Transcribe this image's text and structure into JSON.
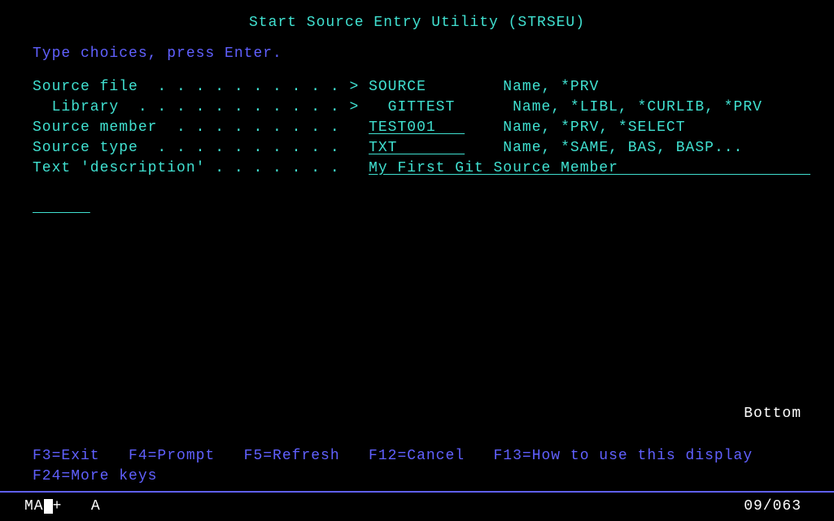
{
  "title": "Start Source Entry Utility  (STRSEU)",
  "instruction": "Type choices, press Enter.",
  "fields": {
    "source_file": {
      "label": "Source file  . . . . . . . . . . > ",
      "value": "SOURCE       ",
      "hint": " Name, *PRV"
    },
    "library": {
      "label": "  Library  . . . . . . . . . . . >  ",
      "value": " GITTEST     ",
      "hint": " Name, *LIBL, *CURLIB, *PRV"
    },
    "source_member": {
      "label": "Source member  . . . . . . . . .   ",
      "value": "TEST001   ",
      "hint": "    Name, *PRV, *SELECT"
    },
    "source_type": {
      "label": "Source type  . . . . . . . . . .   ",
      "value": "TXT       ",
      "hint": "    Name, *SAME, BAS, BASP..."
    },
    "text_desc": {
      "label": "Text 'description' . . . . . . .   ",
      "value": "My First Git Source Member                    "
    }
  },
  "empty_field": "      ",
  "bottom": "Bottom",
  "fkeys_line1": "F3=Exit   F4=Prompt   F5=Refresh   F12=Cancel   F13=How to use this display",
  "fkeys_line2": "F24=More keys",
  "status": {
    "left_ma": "MA",
    "left_plus": "+",
    "left_a": "   A",
    "position": "09/063"
  }
}
